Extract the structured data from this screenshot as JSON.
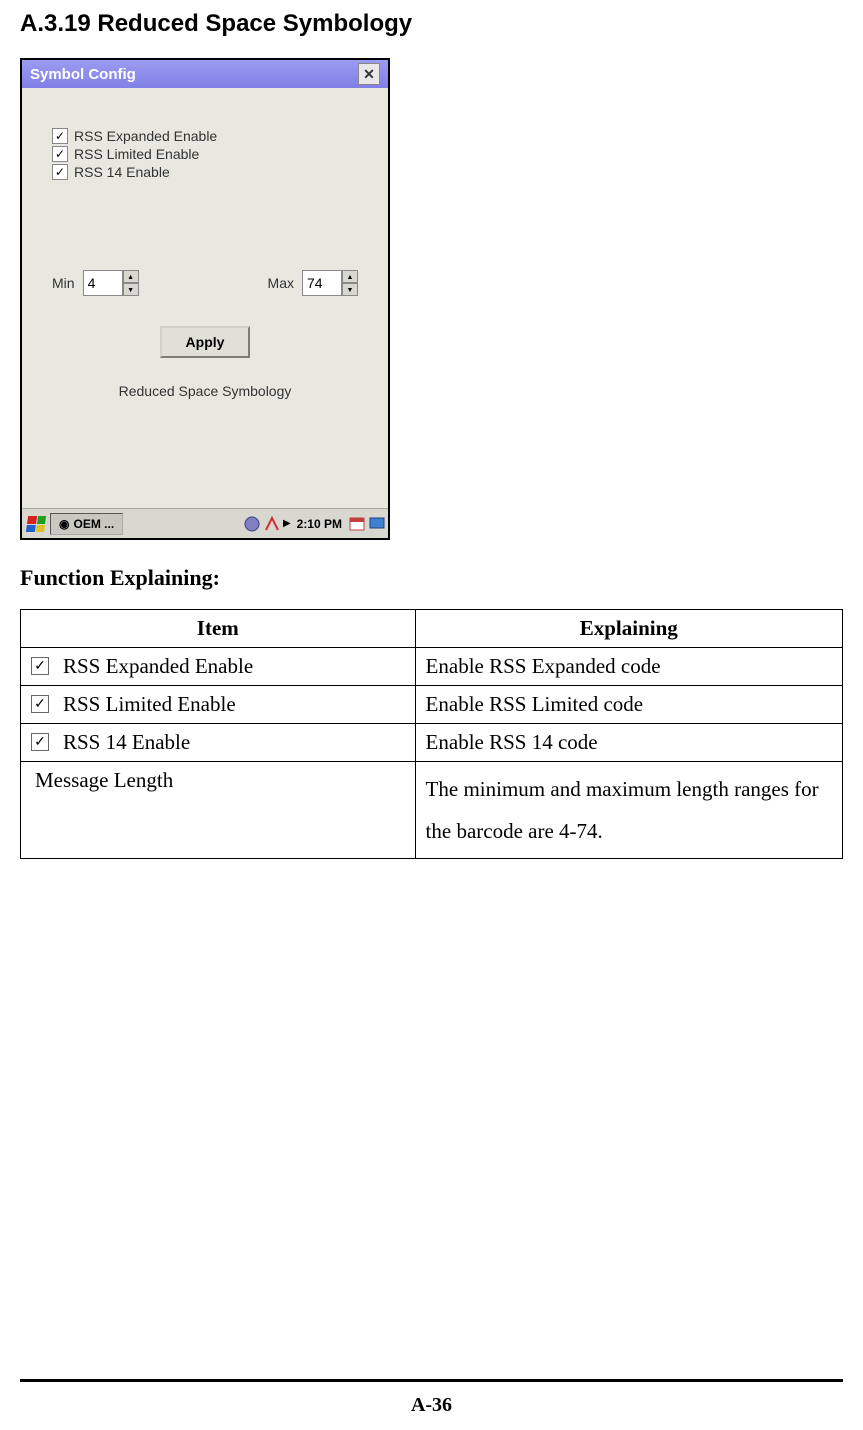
{
  "heading": "A.3.19 Reduced Space Symbology",
  "dialog": {
    "title": "Symbol Config",
    "checkboxes": [
      {
        "label": "RSS Expanded Enable",
        "checked": true
      },
      {
        "label": "RSS Limited Enable",
        "checked": true
      },
      {
        "label": "RSS 14 Enable",
        "checked": true
      }
    ],
    "min_label": "Min",
    "min_value": "4",
    "max_label": "Max",
    "max_value": "74",
    "apply_label": "Apply",
    "caption": "Reduced Space Symbology"
  },
  "taskbar": {
    "app_label": "OEM ...",
    "time": "2:10 PM"
  },
  "function_heading": "Function Explaining:",
  "table": {
    "headers": [
      "Item",
      "Explaining"
    ],
    "rows": [
      {
        "has_checkbox": true,
        "item": "RSS Expanded Enable",
        "explaining": "Enable RSS Expanded code"
      },
      {
        "has_checkbox": true,
        "item": "RSS Limited Enable",
        "explaining": "Enable RSS Limited code"
      },
      {
        "has_checkbox": true,
        "item": "RSS 14 Enable",
        "explaining": "Enable RSS 14 code"
      },
      {
        "has_checkbox": false,
        "item": "Message Length",
        "explaining": "The minimum and maximum length ranges for the barcode are 4-74."
      }
    ]
  },
  "page_number": "A-36"
}
